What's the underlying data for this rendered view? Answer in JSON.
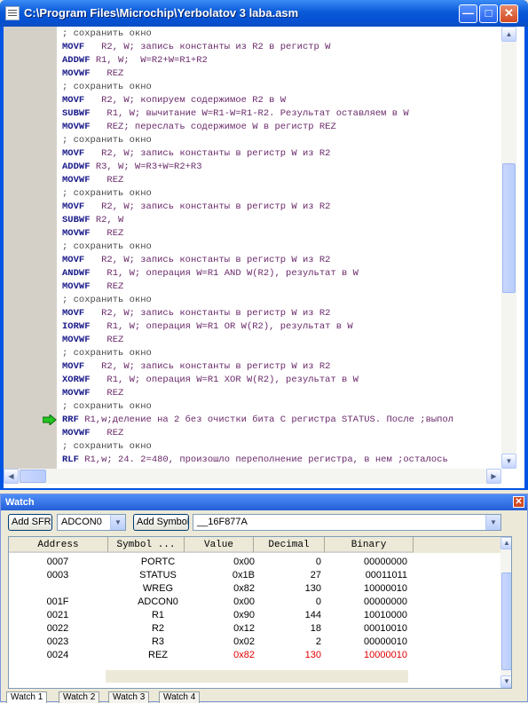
{
  "editor": {
    "title": "C:\\Program Files\\Microchip\\Yerbolatov 3 laba.asm",
    "lines": [
      {
        "op": "",
        "rest": "; сохранить окно",
        "comment": true
      },
      {
        "op": "MOVF",
        "rest": "   R2, W; запись константы из R2 в регистр W"
      },
      {
        "op": "ADDWF",
        "rest": " R1, W;  W=R2+W=R1+R2"
      },
      {
        "op": "MOVWF",
        "rest": "   REZ"
      },
      {
        "op": "",
        "rest": "; сохранить окно",
        "comment": true
      },
      {
        "op": "MOVF",
        "rest": "   R2, W; копируем содержимое R2 в W"
      },
      {
        "op": "SUBWF",
        "rest": "   R1, W; вычитание W=R1-W=R1-R2. Результат оставляем в W"
      },
      {
        "op": "MOVWF",
        "rest": "   REZ; переслать содержимое W в регистр REZ"
      },
      {
        "op": "",
        "rest": "; сохранить окно",
        "comment": true
      },
      {
        "op": "MOVF",
        "rest": "   R2, W; запись константы в регистр W из R2"
      },
      {
        "op": "ADDWF",
        "rest": " R3, W; W=R3+W=R2+R3"
      },
      {
        "op": "MOVWF",
        "rest": "   REZ"
      },
      {
        "op": "",
        "rest": "; сохранить окно",
        "comment": true
      },
      {
        "op": "MOVF",
        "rest": "   R2, W; запись константы в регистр W из R2"
      },
      {
        "op": "SUBWF",
        "rest": " R2, W"
      },
      {
        "op": "MOVWF",
        "rest": "   REZ"
      },
      {
        "op": "",
        "rest": "; сохранить окно",
        "comment": true
      },
      {
        "op": "MOVF",
        "rest": "   R2, W; запись константы в регистр W из R2"
      },
      {
        "op": "ANDWF",
        "rest": "   R1, W; операция W=R1 AND W(R2), результат в W"
      },
      {
        "op": "MOVWF",
        "rest": "   REZ"
      },
      {
        "op": "",
        "rest": "; сохранить окно",
        "comment": true
      },
      {
        "op": "MOVF",
        "rest": "   R2, W; запись константы в регистр W из R2"
      },
      {
        "op": "IORWF",
        "rest": "   R1, W; операция W=R1 OR W(R2), результат в W"
      },
      {
        "op": "MOVWF",
        "rest": "   REZ"
      },
      {
        "op": "",
        "rest": "; сохранить окно",
        "comment": true
      },
      {
        "op": "MOVF",
        "rest": "   R2, W; запись константы в регистр W из R2"
      },
      {
        "op": "XORWF",
        "rest": "   R1, W; операция W=R1 XOR W(R2), результат в W"
      },
      {
        "op": "MOVWF",
        "rest": "   REZ"
      },
      {
        "op": "",
        "rest": "; сохранить окно",
        "comment": true
      },
      {
        "op": "RRF",
        "rest": " R1,w;деление на 2 без очистки бита С регистра STATUS. После ;выпол"
      },
      {
        "op": "MOVWF",
        "rest": "   REZ"
      },
      {
        "op": "",
        "rest": "; сохранить окно",
        "comment": true
      },
      {
        "op": "RLF",
        "rest": " R1,w; 24. 2=480, произошло переполнение регистра, в нем ;осталось"
      }
    ]
  },
  "watch": {
    "title": "Watch",
    "add_sfr": "Add SFR",
    "sfr_value": "ADCON0",
    "add_symbol": "Add Symbol",
    "symbol_value": "__16F877A",
    "columns": [
      "Address",
      "Symbol ...",
      "Value",
      "Decimal",
      "Binary"
    ],
    "rows": [
      {
        "address": "0007",
        "symbol": "PORTC",
        "value": "0x00",
        "decimal": "0",
        "binary": "00000000",
        "changed": false
      },
      {
        "address": "0003",
        "symbol": "STATUS",
        "value": "0x1B",
        "decimal": "27",
        "binary": "00011011",
        "changed": false
      },
      {
        "address": "",
        "symbol": "WREG",
        "value": "0x82",
        "decimal": "130",
        "binary": "10000010",
        "changed": false
      },
      {
        "address": "001F",
        "symbol": "ADCON0",
        "value": "0x00",
        "decimal": "0",
        "binary": "00000000",
        "changed": false
      },
      {
        "address": "0021",
        "symbol": "R1",
        "value": "0x90",
        "decimal": "144",
        "binary": "10010000",
        "changed": false
      },
      {
        "address": "0022",
        "symbol": "R2",
        "value": "0x12",
        "decimal": "18",
        "binary": "00010010",
        "changed": false
      },
      {
        "address": "0023",
        "symbol": "R3",
        "value": "0x02",
        "decimal": "2",
        "binary": "00000010",
        "changed": false
      },
      {
        "address": "0024",
        "symbol": "REZ",
        "value": "0x82",
        "decimal": "130",
        "binary": "10000010",
        "changed": true
      }
    ],
    "tabs": [
      "Watch 1",
      "Watch 2",
      "Watch 3",
      "Watch 4"
    ]
  },
  "icons": {
    "execution": "green-arrow-icon",
    "minimize": "minimize-icon",
    "maximize": "maximize-icon",
    "close": "close-icon"
  }
}
